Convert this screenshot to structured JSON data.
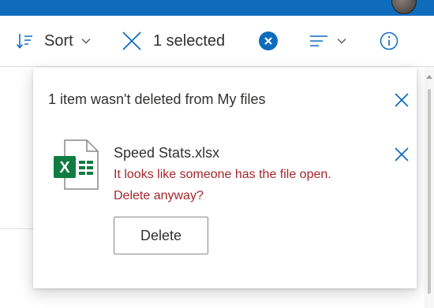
{
  "colors": {
    "accent": "#0f6cbd",
    "error": "#a4262c",
    "excel_green": "#107c41"
  },
  "commandbar": {
    "sort": {
      "icon": "sort-icon",
      "label": "Sort",
      "chevron": "chevron-down-icon"
    },
    "selection": {
      "icon": "close-icon",
      "label": "1 selected"
    },
    "clear_selection": {
      "icon": "clear-circle-icon"
    },
    "view_options": {
      "icon": "lines-icon",
      "chevron": "chevron-down-icon"
    },
    "info": {
      "icon": "info-icon"
    }
  },
  "dialog": {
    "title": "1 item wasn't deleted from My files",
    "dismiss_icon": "close-icon",
    "item": {
      "file_icon": "excel-file-icon",
      "file_icon_letter": "X",
      "file_name": "Speed Stats.xlsx",
      "error_line1": "It looks like someone has the file open.",
      "error_line2": "Delete anyway?",
      "delete_label": "Delete",
      "dismiss_icon": "close-icon"
    }
  }
}
